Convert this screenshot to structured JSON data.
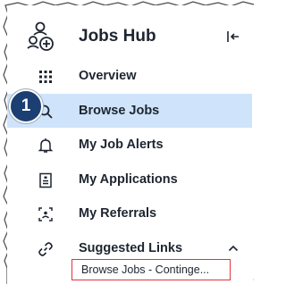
{
  "app": {
    "title": "Jobs Hub",
    "hub_icon": "people-add-icon",
    "collapse_icon": "collapse-left-icon"
  },
  "nav": {
    "items": [
      {
        "label": "Overview",
        "icon": "grid-icon",
        "active": false
      },
      {
        "label": "Browse Jobs",
        "icon": "search-icon",
        "active": true
      },
      {
        "label": "My Job Alerts",
        "icon": "bell-icon",
        "active": false
      },
      {
        "label": "My Applications",
        "icon": "document-icon",
        "active": false
      },
      {
        "label": "My Referrals",
        "icon": "referral-icon",
        "active": false
      },
      {
        "label": "Suggested Links",
        "icon": "link-icon",
        "active": false,
        "expanded": true
      }
    ],
    "sub_links": [
      {
        "label": "Browse Jobs - Continge..."
      }
    ]
  },
  "annotation": {
    "step_number": "1"
  },
  "colors": {
    "active_bg": "#cfe4fb",
    "text": "#1e2530",
    "highlight_border": "#e0353b",
    "badge_bg": "#1c3f73"
  }
}
